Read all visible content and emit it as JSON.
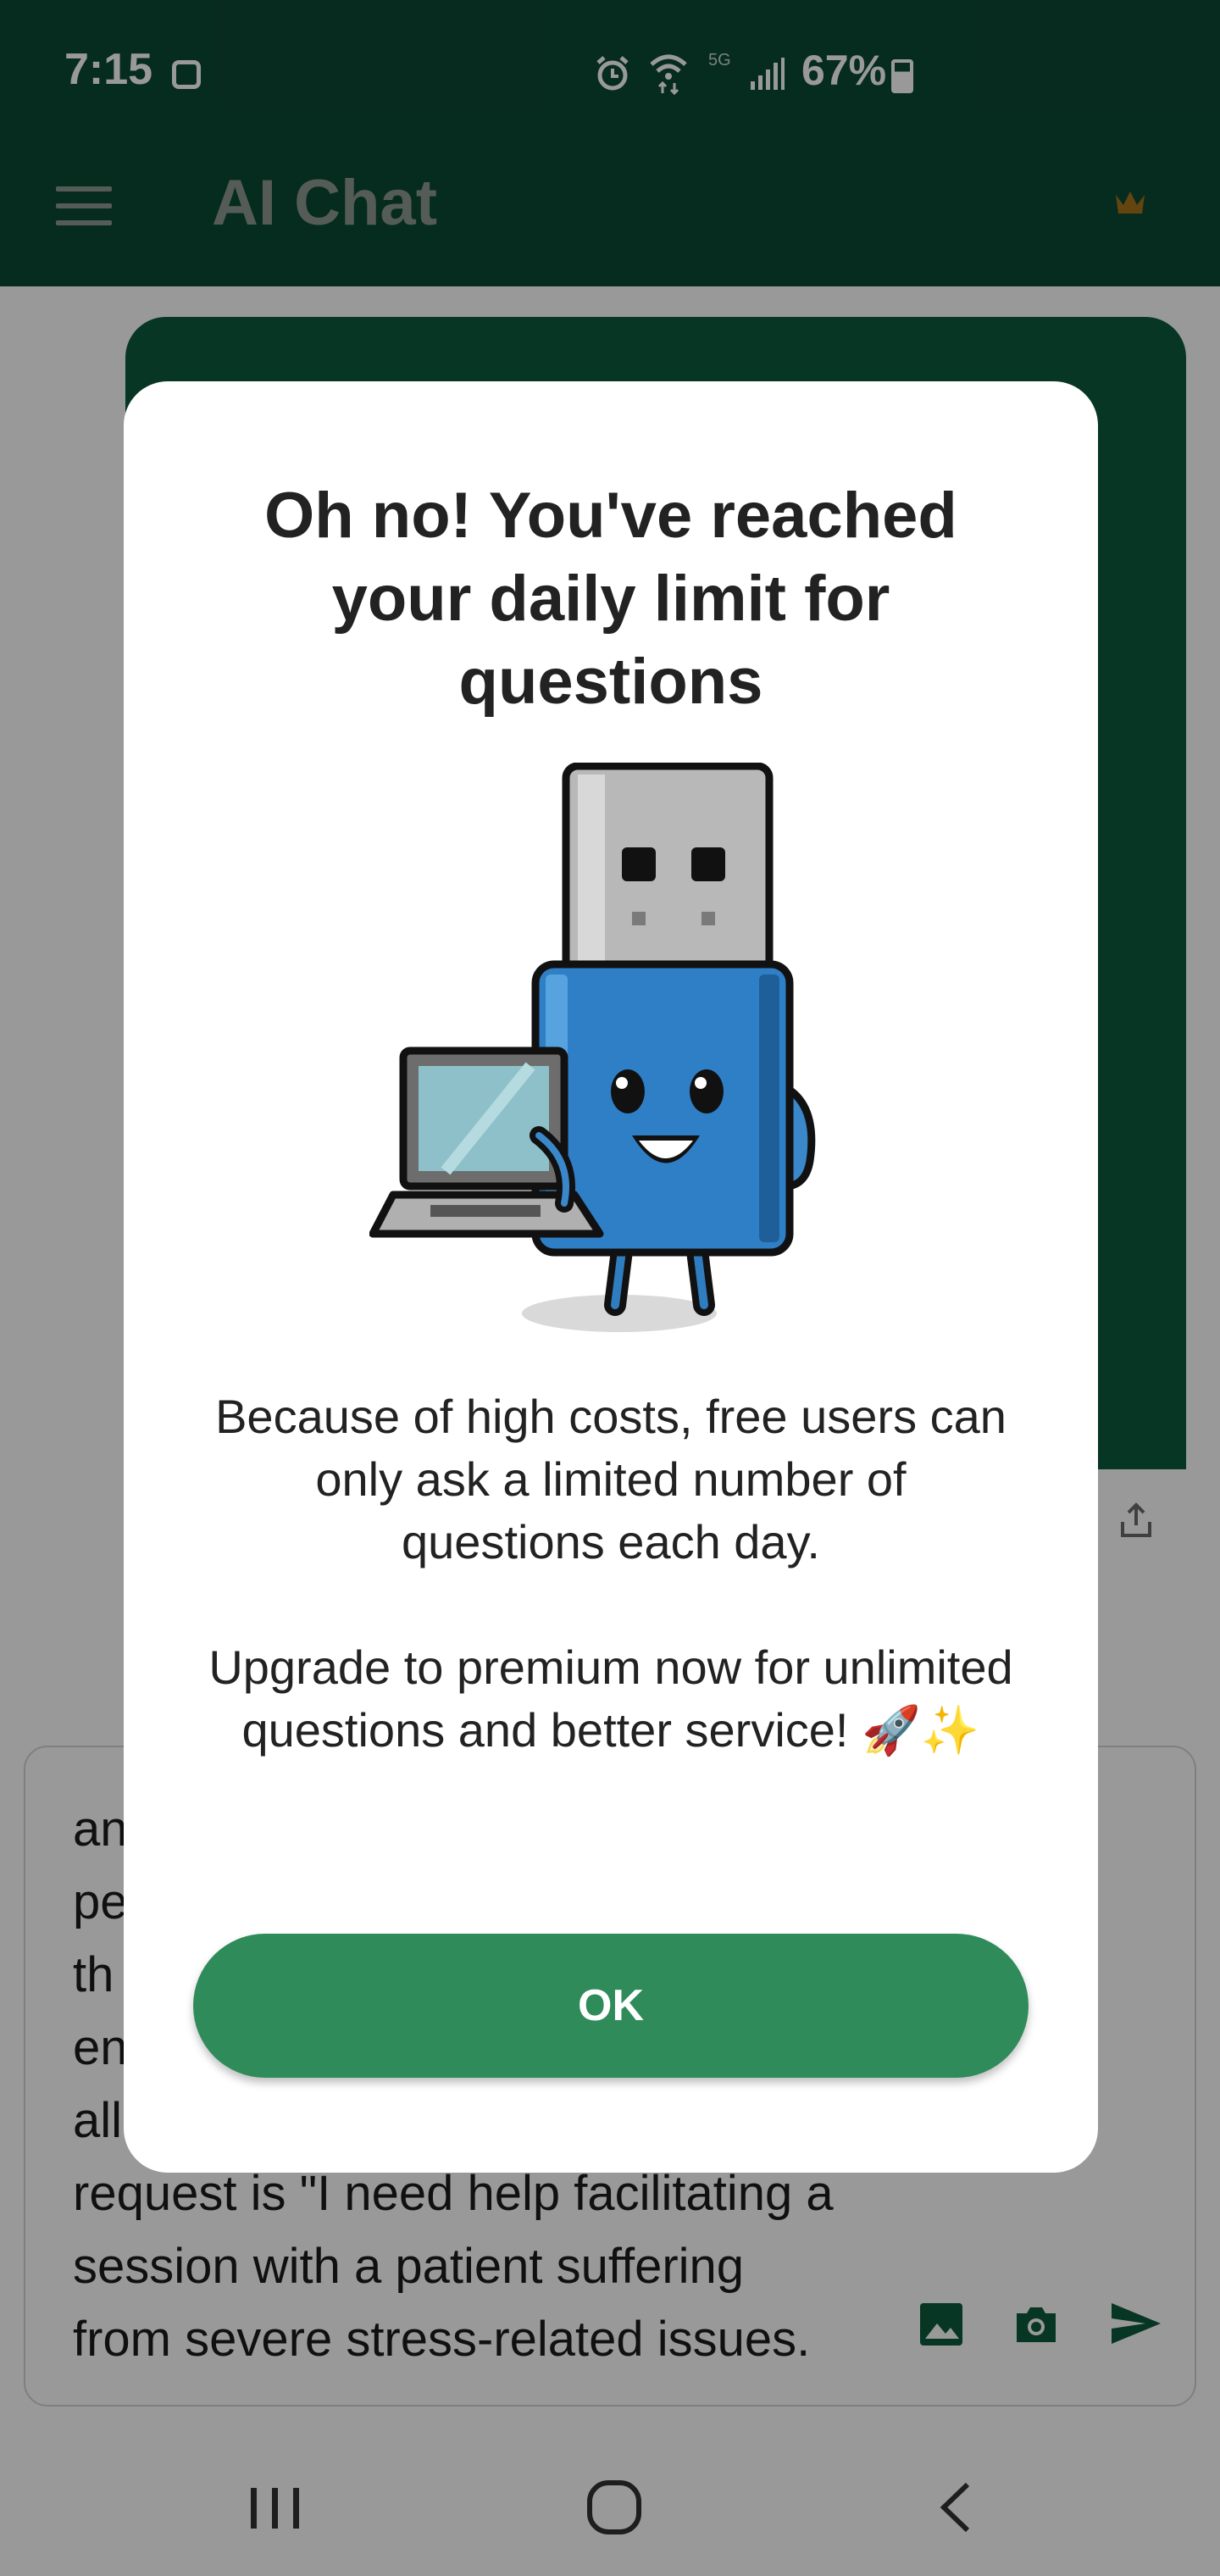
{
  "status_bar": {
    "time": "7:15",
    "network": "5G",
    "battery": "67%"
  },
  "app_bar": {
    "title": "AI Chat",
    "menu_icon": "hamburger-menu-icon",
    "premium_icon": "crown-icon"
  },
  "chat": {
    "input_text": "an\npe\nth\nen\nall\nrequest is \"I need help facilitating a\nsession with a patient suffering\nfrom severe stress-related issues.",
    "icons": [
      "image-icon",
      "camera-icon",
      "send-icon",
      "share-icon"
    ]
  },
  "dialog": {
    "title": "Oh no! You've reached your daily limit for questions",
    "body": "Because of high costs, free users can only ask a limited number of questions each day.\n\nUpgrade to premium now for unlimited questions and better service! 🚀✨",
    "ok_label": "OK",
    "illustration": "usb-mascot-with-laptop"
  },
  "colors": {
    "header": "#0b4a34",
    "bubble": "#0d5b3d",
    "button": "#2f8b5a"
  },
  "nav": {
    "items": [
      "recent-apps-icon",
      "home-icon",
      "back-icon"
    ]
  }
}
